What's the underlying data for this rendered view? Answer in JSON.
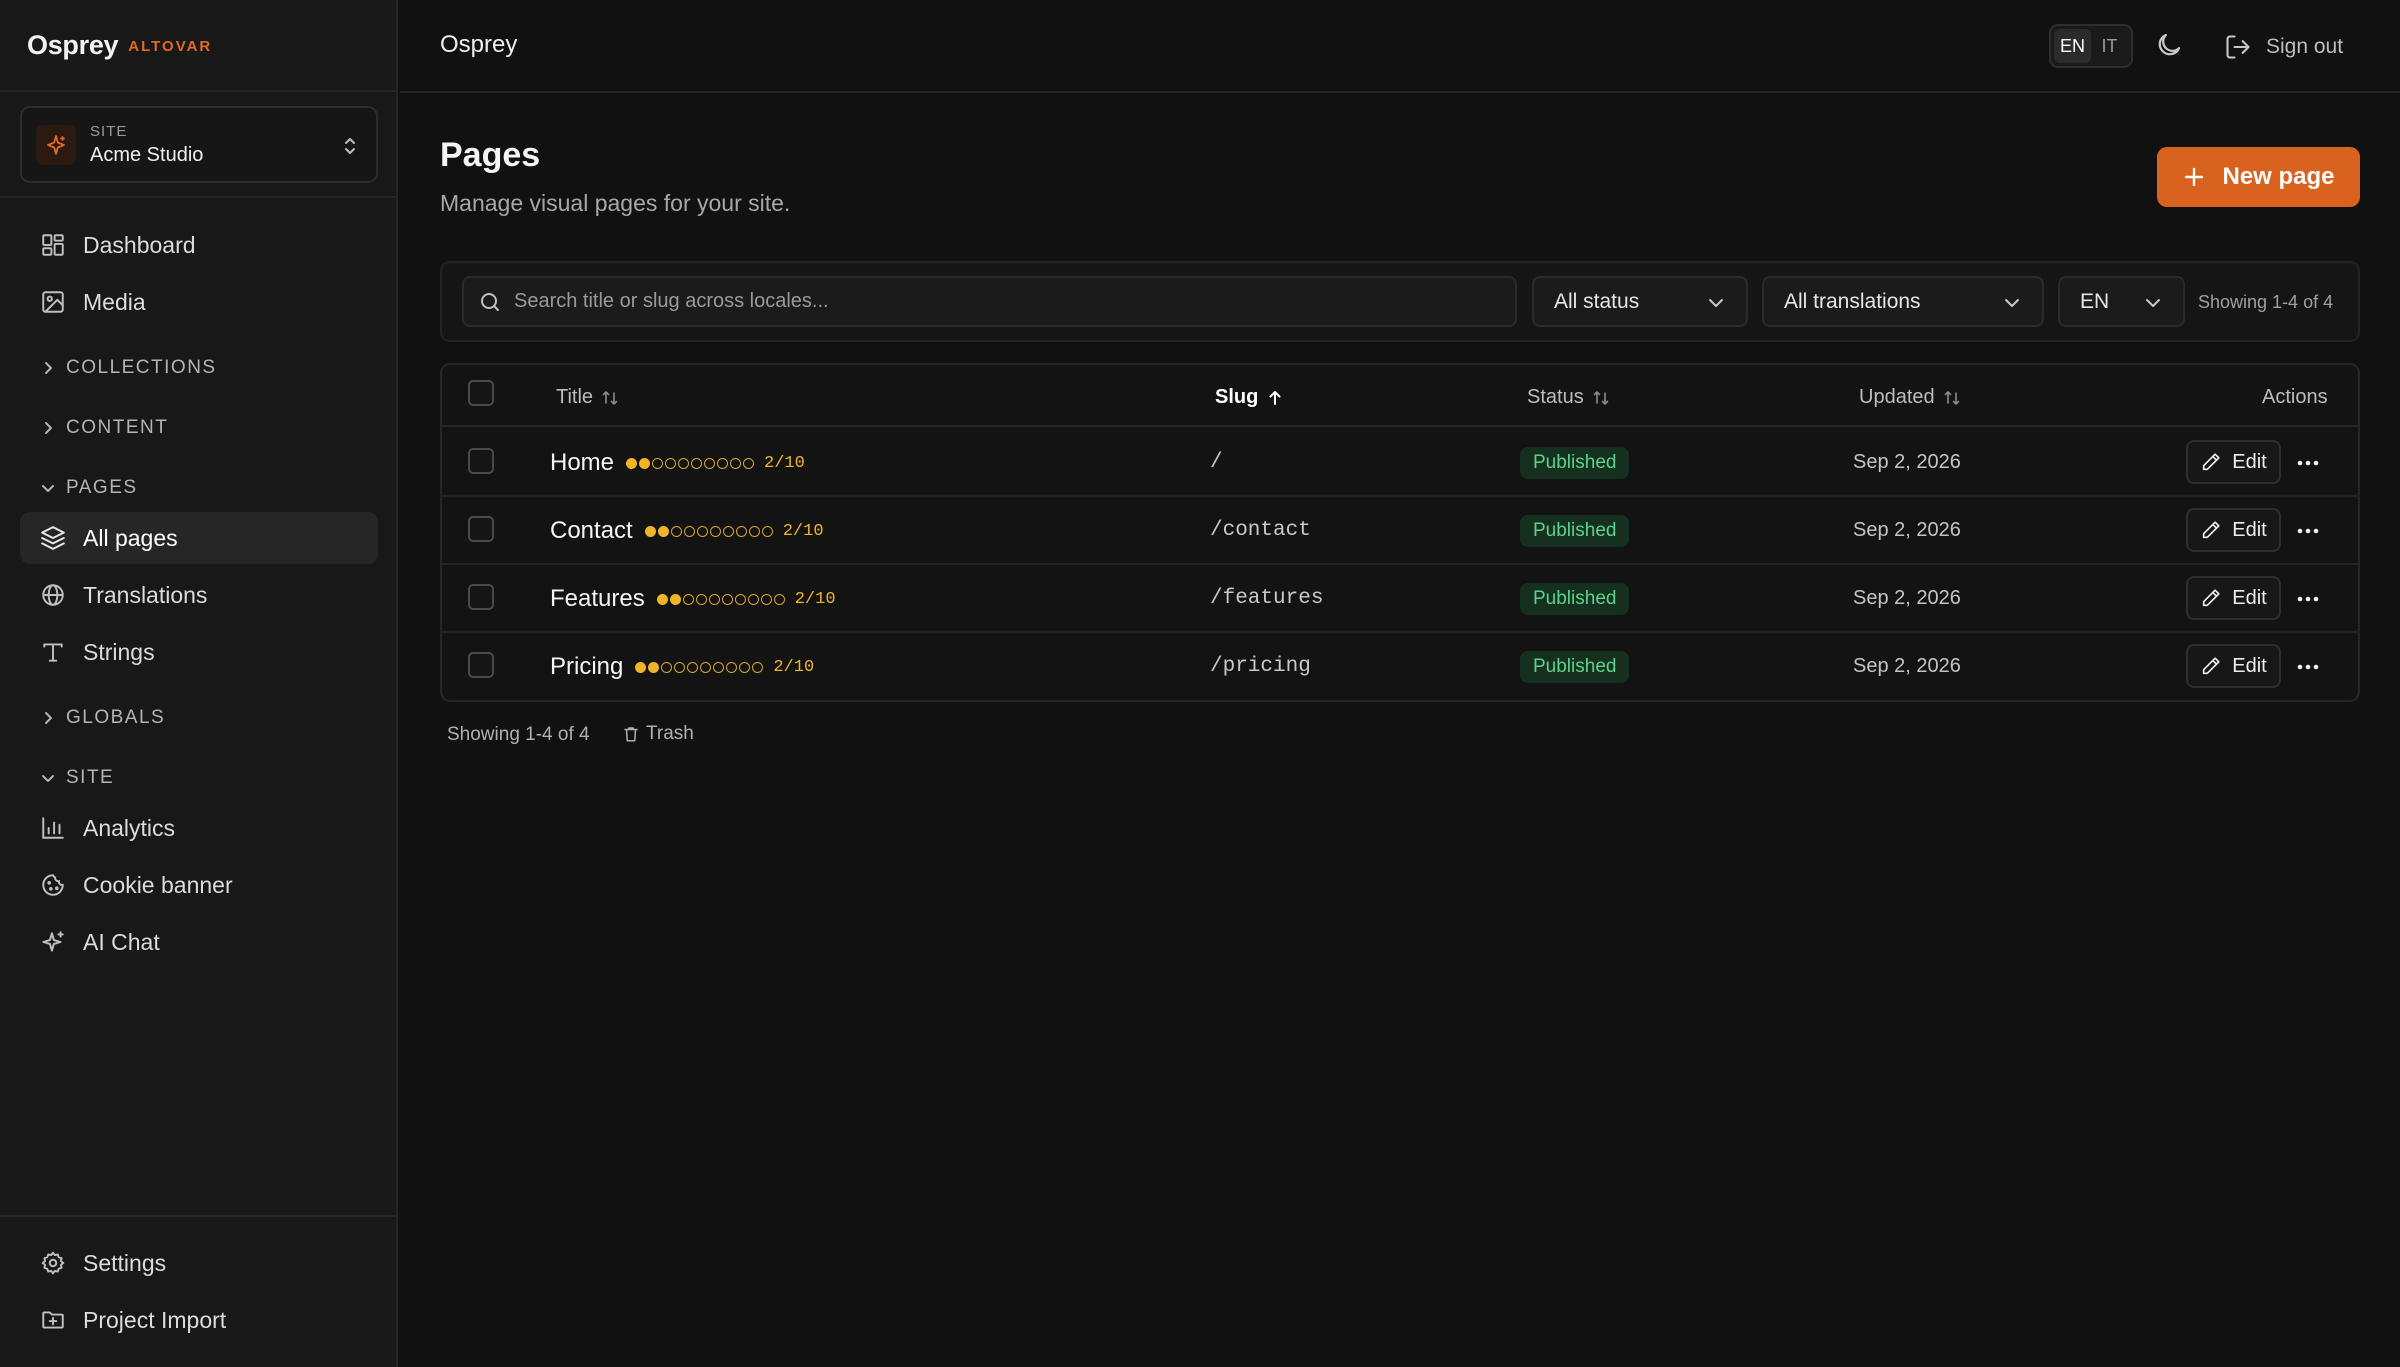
{
  "brand": {
    "name": "Osprey",
    "tag": "ALTOVAR"
  },
  "site_selector": {
    "label": "SITE",
    "name": "Acme Studio"
  },
  "sidebar": {
    "dashboard": "Dashboard",
    "media": "Media",
    "sections": {
      "collections": "COLLECTIONS",
      "content": "CONTENT",
      "pages": "PAGES",
      "globals": "GLOBALS",
      "site": "SITE"
    },
    "pages_items": {
      "all_pages": "All pages",
      "translations": "Translations",
      "strings": "Strings"
    },
    "site_items": {
      "analytics": "Analytics",
      "cookie_banner": "Cookie banner",
      "ai_chat": "AI Chat"
    },
    "bottom": {
      "settings": "Settings",
      "project_import": "Project Import"
    },
    "active_item": "All pages"
  },
  "header": {
    "title": "Osprey",
    "languages": [
      "EN",
      "IT"
    ],
    "active_language": "EN",
    "sign_out": "Sign out"
  },
  "main": {
    "title": "Pages",
    "subtitle": "Manage visual pages for your site.",
    "new_button": "New page"
  },
  "filters": {
    "search_placeholder": "Search title or slug across locales...",
    "status": "All status",
    "translations": "All translations",
    "locale": "EN",
    "showing": "Showing 1-4 of 4"
  },
  "table": {
    "columns": {
      "title": "Title",
      "slug": "Slug",
      "status": "Status",
      "updated": "Updated",
      "actions": "Actions"
    },
    "sorted_column": "Slug",
    "rows": [
      {
        "title": "Home",
        "score": "2/10",
        "score_filled": 2,
        "score_total": 10,
        "slug": "/",
        "status": "Published",
        "updated": "Sep 2, 2026",
        "edit": "Edit"
      },
      {
        "title": "Contact",
        "score": "2/10",
        "score_filled": 2,
        "score_total": 10,
        "slug": "/contact",
        "status": "Published",
        "updated": "Sep 2, 2026",
        "edit": "Edit"
      },
      {
        "title": "Features",
        "score": "2/10",
        "score_filled": 2,
        "score_total": 10,
        "slug": "/features",
        "status": "Published",
        "updated": "Sep 2, 2026",
        "edit": "Edit"
      },
      {
        "title": "Pricing",
        "score": "2/10",
        "score_filled": 2,
        "score_total": 10,
        "slug": "/pricing",
        "status": "Published",
        "updated": "Sep 2, 2026",
        "edit": "Edit"
      }
    ]
  },
  "footer": {
    "showing": "Showing 1-4 of 4",
    "trash": "Trash"
  },
  "colors": {
    "accent": "#d9621f",
    "score": "#f0b428",
    "published_bg": "#16301f",
    "published_text": "#5cd38b"
  }
}
